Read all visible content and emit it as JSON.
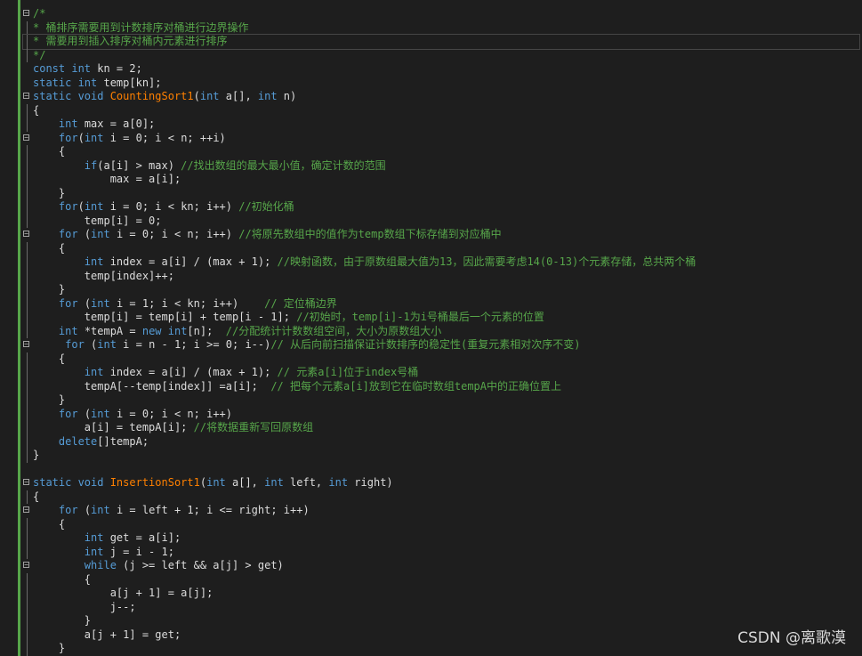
{
  "watermark": "CSDN @离歌漠",
  "lines": [
    {
      "fold": "box",
      "segs": [
        {
          "c": "cm",
          "t": "/*"
        }
      ]
    },
    {
      "fold": "line",
      "segs": [
        {
          "c": "cm",
          "t": "* 桶排序需要用到计数排序对桶进行边界操作"
        }
      ]
    },
    {
      "fold": "line",
      "cur": true,
      "segs": [
        {
          "c": "cm",
          "t": "* 需要用到插入排序对桶内元素进行排序"
        }
      ]
    },
    {
      "fold": "line",
      "segs": [
        {
          "c": "cm",
          "t": "*/"
        }
      ]
    },
    {
      "fold": "",
      "segs": [
        {
          "c": "kw",
          "t": "const int "
        },
        {
          "c": "tx",
          "t": "kn = 2;"
        }
      ]
    },
    {
      "fold": "",
      "segs": [
        {
          "c": "kw",
          "t": "static int "
        },
        {
          "c": "tx",
          "t": "temp[kn];"
        }
      ]
    },
    {
      "fold": "box",
      "segs": [
        {
          "c": "kw",
          "t": "static void "
        },
        {
          "c": "fn",
          "t": "CountingSort1"
        },
        {
          "c": "tx",
          "t": "("
        },
        {
          "c": "kw",
          "t": "int "
        },
        {
          "c": "tx",
          "t": "a[], "
        },
        {
          "c": "kw",
          "t": "int "
        },
        {
          "c": "tx",
          "t": "n)"
        }
      ]
    },
    {
      "fold": "line",
      "segs": [
        {
          "c": "tx",
          "t": "{"
        }
      ]
    },
    {
      "fold": "line",
      "segs": [
        {
          "c": "tx",
          "t": "    "
        },
        {
          "c": "kw",
          "t": "int "
        },
        {
          "c": "tx",
          "t": "max = a[0];"
        }
      ]
    },
    {
      "fold": "box",
      "segs": [
        {
          "c": "tx",
          "t": "    "
        },
        {
          "c": "kw",
          "t": "for"
        },
        {
          "c": "tx",
          "t": "("
        },
        {
          "c": "kw",
          "t": "int "
        },
        {
          "c": "tx",
          "t": "i = 0; i < n; ++i)"
        }
      ]
    },
    {
      "fold": "line",
      "segs": [
        {
          "c": "tx",
          "t": "    {"
        }
      ]
    },
    {
      "fold": "line",
      "segs": [
        {
          "c": "tx",
          "t": "        "
        },
        {
          "c": "kw",
          "t": "if"
        },
        {
          "c": "tx",
          "t": "(a[i] > max) "
        },
        {
          "c": "cm",
          "t": "//找出数组的最大最小值，确定计数的范围"
        }
      ]
    },
    {
      "fold": "line",
      "segs": [
        {
          "c": "tx",
          "t": "            max = a[i];"
        }
      ]
    },
    {
      "fold": "line",
      "segs": [
        {
          "c": "tx",
          "t": "    }"
        }
      ]
    },
    {
      "fold": "line",
      "segs": [
        {
          "c": "tx",
          "t": "    "
        },
        {
          "c": "kw",
          "t": "for"
        },
        {
          "c": "tx",
          "t": "("
        },
        {
          "c": "kw",
          "t": "int "
        },
        {
          "c": "tx",
          "t": "i = 0; i < kn; i++) "
        },
        {
          "c": "cm",
          "t": "//初始化桶"
        }
      ]
    },
    {
      "fold": "line",
      "segs": [
        {
          "c": "tx",
          "t": "        temp[i] = 0;"
        }
      ]
    },
    {
      "fold": "box",
      "segs": [
        {
          "c": "tx",
          "t": "    "
        },
        {
          "c": "kw",
          "t": "for "
        },
        {
          "c": "tx",
          "t": "("
        },
        {
          "c": "kw",
          "t": "int "
        },
        {
          "c": "tx",
          "t": "i = 0; i < n; i++) "
        },
        {
          "c": "cm",
          "t": "//将原先数组中的值作为temp数组下标存储到对应桶中"
        }
      ]
    },
    {
      "fold": "line",
      "segs": [
        {
          "c": "tx",
          "t": "    {"
        }
      ]
    },
    {
      "fold": "line",
      "segs": [
        {
          "c": "tx",
          "t": "        "
        },
        {
          "c": "kw",
          "t": "int "
        },
        {
          "c": "tx",
          "t": "index = a[i] / (max + 1); "
        },
        {
          "c": "cm",
          "t": "//映射函数，由于原数组最大值为13，因此需要考虑14(0-13)个元素存储，总共两个桶"
        }
      ]
    },
    {
      "fold": "line",
      "segs": [
        {
          "c": "tx",
          "t": "        temp[index]++;"
        }
      ]
    },
    {
      "fold": "line",
      "segs": [
        {
          "c": "tx",
          "t": "    }"
        }
      ]
    },
    {
      "fold": "line",
      "segs": [
        {
          "c": "tx",
          "t": "    "
        },
        {
          "c": "kw",
          "t": "for "
        },
        {
          "c": "tx",
          "t": "("
        },
        {
          "c": "kw",
          "t": "int "
        },
        {
          "c": "tx",
          "t": "i = 1; i < kn; i++)    "
        },
        {
          "c": "cm",
          "t": "// 定位桶边界"
        }
      ]
    },
    {
      "fold": "line",
      "segs": [
        {
          "c": "tx",
          "t": "        temp[i] = temp[i] + temp[i - 1]; "
        },
        {
          "c": "cm",
          "t": "//初始时，temp[i]-1为i号桶最后一个元素的位置"
        }
      ]
    },
    {
      "fold": "line",
      "segs": [
        {
          "c": "tx",
          "t": "    "
        },
        {
          "c": "kw",
          "t": "int "
        },
        {
          "c": "tx",
          "t": "*tempA = "
        },
        {
          "c": "kw",
          "t": "new int"
        },
        {
          "c": "tx",
          "t": "[n];  "
        },
        {
          "c": "cm",
          "t": "//分配统计计数数组空间，大小为原数组大小"
        }
      ]
    },
    {
      "fold": "box",
      "segs": [
        {
          "c": "tx",
          "t": "     "
        },
        {
          "c": "kw",
          "t": "for "
        },
        {
          "c": "tx",
          "t": "("
        },
        {
          "c": "kw",
          "t": "int "
        },
        {
          "c": "tx",
          "t": "i = n - 1; i >= 0; i--)"
        },
        {
          "c": "cm",
          "t": "// 从后向前扫描保证计数排序的稳定性(重复元素相对次序不变)"
        }
      ]
    },
    {
      "fold": "line",
      "segs": [
        {
          "c": "tx",
          "t": "    {"
        }
      ]
    },
    {
      "fold": "line",
      "segs": [
        {
          "c": "tx",
          "t": "        "
        },
        {
          "c": "kw",
          "t": "int "
        },
        {
          "c": "tx",
          "t": "index = a[i] / (max + 1); "
        },
        {
          "c": "cm",
          "t": "// 元素a[i]位于index号桶"
        }
      ]
    },
    {
      "fold": "line",
      "segs": [
        {
          "c": "tx",
          "t": "        tempA[--temp[index]] =a[i];  "
        },
        {
          "c": "cm",
          "t": "// 把每个元素a[i]放到它在临时数组tempA中的正确位置上"
        }
      ]
    },
    {
      "fold": "line",
      "segs": [
        {
          "c": "tx",
          "t": "    }"
        }
      ]
    },
    {
      "fold": "line",
      "segs": [
        {
          "c": "tx",
          "t": "    "
        },
        {
          "c": "kw",
          "t": "for "
        },
        {
          "c": "tx",
          "t": "("
        },
        {
          "c": "kw",
          "t": "int "
        },
        {
          "c": "tx",
          "t": "i = 0; i < n; i++)"
        }
      ]
    },
    {
      "fold": "line",
      "segs": [
        {
          "c": "tx",
          "t": "        a[i] = tempA[i]; "
        },
        {
          "c": "cm",
          "t": "//将数据重新写回原数组"
        }
      ]
    },
    {
      "fold": "line",
      "segs": [
        {
          "c": "tx",
          "t": "    "
        },
        {
          "c": "kw",
          "t": "delete"
        },
        {
          "c": "tx",
          "t": "[]tempA;"
        }
      ]
    },
    {
      "fold": "line",
      "segs": [
        {
          "c": "tx",
          "t": "}"
        }
      ]
    },
    {
      "fold": "",
      "segs": [
        {
          "c": "tx",
          "t": ""
        }
      ]
    },
    {
      "fold": "box",
      "segs": [
        {
          "c": "kw",
          "t": "static void "
        },
        {
          "c": "fn",
          "t": "InsertionSort1"
        },
        {
          "c": "tx",
          "t": "("
        },
        {
          "c": "kw",
          "t": "int "
        },
        {
          "c": "tx",
          "t": "a[], "
        },
        {
          "c": "kw",
          "t": "int "
        },
        {
          "c": "tx",
          "t": "left, "
        },
        {
          "c": "kw",
          "t": "int "
        },
        {
          "c": "tx",
          "t": "right)"
        }
      ]
    },
    {
      "fold": "line",
      "segs": [
        {
          "c": "tx",
          "t": "{"
        }
      ]
    },
    {
      "fold": "box",
      "segs": [
        {
          "c": "tx",
          "t": "    "
        },
        {
          "c": "kw",
          "t": "for "
        },
        {
          "c": "tx",
          "t": "("
        },
        {
          "c": "kw",
          "t": "int "
        },
        {
          "c": "tx",
          "t": "i = left + 1; i <= right; i++)"
        }
      ]
    },
    {
      "fold": "line",
      "segs": [
        {
          "c": "tx",
          "t": "    {"
        }
      ]
    },
    {
      "fold": "line",
      "segs": [
        {
          "c": "tx",
          "t": "        "
        },
        {
          "c": "kw",
          "t": "int "
        },
        {
          "c": "tx",
          "t": "get = a[i];"
        }
      ]
    },
    {
      "fold": "line",
      "segs": [
        {
          "c": "tx",
          "t": "        "
        },
        {
          "c": "kw",
          "t": "int "
        },
        {
          "c": "tx",
          "t": "j = i - 1;"
        }
      ]
    },
    {
      "fold": "box",
      "segs": [
        {
          "c": "tx",
          "t": "        "
        },
        {
          "c": "kw",
          "t": "while "
        },
        {
          "c": "tx",
          "t": "(j >= left && a[j] > get)"
        }
      ]
    },
    {
      "fold": "line",
      "segs": [
        {
          "c": "tx",
          "t": "        {"
        }
      ]
    },
    {
      "fold": "line",
      "segs": [
        {
          "c": "tx",
          "t": "            a[j + 1] = a[j];"
        }
      ]
    },
    {
      "fold": "line",
      "segs": [
        {
          "c": "tx",
          "t": "            j--;"
        }
      ]
    },
    {
      "fold": "line",
      "segs": [
        {
          "c": "tx",
          "t": "        }"
        }
      ]
    },
    {
      "fold": "line",
      "segs": [
        {
          "c": "tx",
          "t": "        a[j + 1] = get;"
        }
      ]
    },
    {
      "fold": "line",
      "segs": [
        {
          "c": "tx",
          "t": "    }"
        }
      ]
    }
  ]
}
